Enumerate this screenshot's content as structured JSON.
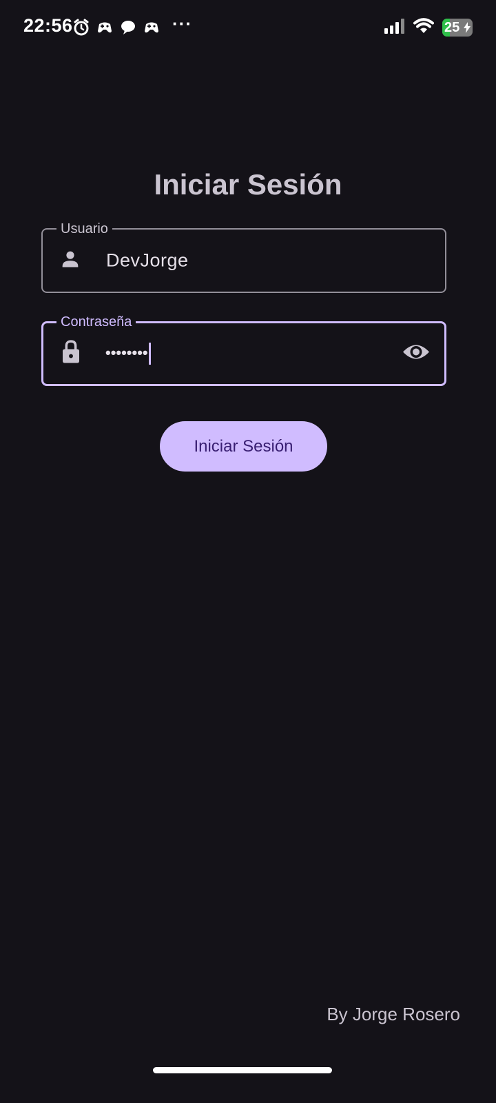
{
  "status_bar": {
    "time": "22:56",
    "icons": [
      "alarm-icon",
      "game-controller-icon",
      "chat-bubble-icon",
      "game-controller-icon",
      "more-icon",
      "signal-icon",
      "wifi-icon",
      "battery-charging-icon"
    ],
    "more": "···",
    "battery_level": "25",
    "battery_fraction": 0.25
  },
  "login": {
    "title": "Iniciar Sesión",
    "username": {
      "label": "Usuario",
      "value": "DevJorge",
      "icon": "person-icon"
    },
    "password": {
      "label": "Contraseña",
      "masked_value": "••••••••",
      "icon": "lock-icon",
      "toggle_icon": "eye-icon"
    },
    "submit_label": "Iniciar Sesión"
  },
  "footer": {
    "credit": "By Jorge Rosero"
  },
  "colors": {
    "background": "#141218",
    "primary": "#d0bcff",
    "on_primary": "#381e72",
    "outline": "#938f99",
    "text_secondary": "#cac4d0"
  }
}
